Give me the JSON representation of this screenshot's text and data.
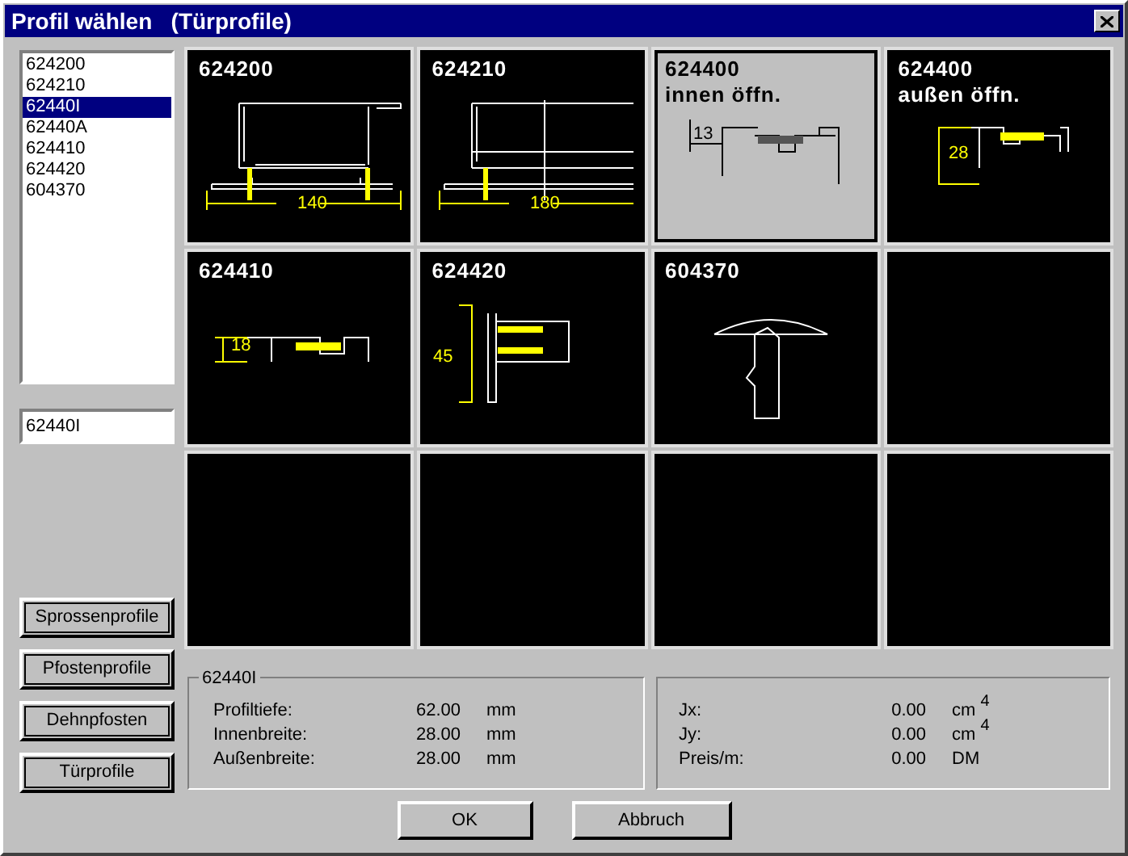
{
  "window": {
    "title": "Profil wählen   (Türprofile)"
  },
  "profile_list": {
    "items": [
      {
        "label": "624200",
        "selected": false
      },
      {
        "label": "624210",
        "selected": false
      },
      {
        "label": "62440I",
        "selected": true
      },
      {
        "label": "62440A",
        "selected": false
      },
      {
        "label": "624410",
        "selected": false
      },
      {
        "label": "624420",
        "selected": false
      },
      {
        "label": "604370",
        "selected": false
      }
    ]
  },
  "profile_field": {
    "value": "62440I"
  },
  "category_buttons": [
    "Sprossenprofile",
    "Pfostenprofile",
    "Dehnpfosten",
    "Türprofile"
  ],
  "tiles": [
    {
      "kind": "profile",
      "lines": [
        "624200"
      ],
      "dimension": "140",
      "selected": false
    },
    {
      "kind": "profile",
      "lines": [
        "624210"
      ],
      "dimension": "180",
      "selected": false
    },
    {
      "kind": "profile",
      "lines": [
        "624400",
        "innen öffn."
      ],
      "dimension": "13",
      "selected": true
    },
    {
      "kind": "profile",
      "lines": [
        "624400",
        "außen öffn."
      ],
      "dimension": "28",
      "selected": false
    },
    {
      "kind": "profile",
      "lines": [
        "624410"
      ],
      "dimension": "18",
      "selected": false
    },
    {
      "kind": "profile",
      "lines": [
        "624420"
      ],
      "dimension": "45",
      "selected": false
    },
    {
      "kind": "profile",
      "lines": [
        "604370"
      ],
      "selected": false
    },
    {
      "kind": "empty",
      "selected": false
    },
    {
      "kind": "empty",
      "selected": false
    },
    {
      "kind": "empty",
      "selected": false
    },
    {
      "kind": "empty",
      "selected": false
    },
    {
      "kind": "empty",
      "selected": false
    }
  ],
  "dimensions": {
    "title": "62440I",
    "rows": [
      {
        "label": "Profiltiefe:",
        "value": "62.00",
        "unit": "mm"
      },
      {
        "label": "Innenbreite:",
        "value": "28.00",
        "unit": "mm"
      },
      {
        "label": "Außenbreite:",
        "value": "28.00",
        "unit": "mm"
      }
    ]
  },
  "properties": {
    "rows": [
      {
        "label": "Jx:",
        "value": "0.00",
        "unit": "cm $^{4}$"
      },
      {
        "label": "Jy:",
        "value": "0.00",
        "unit": "cm $^{4}$"
      },
      {
        "label": "Preis/m:",
        "value": "0.00",
        "unit": "DM"
      }
    ]
  },
  "buttons": [
    "OK",
    "Abbruch"
  ]
}
